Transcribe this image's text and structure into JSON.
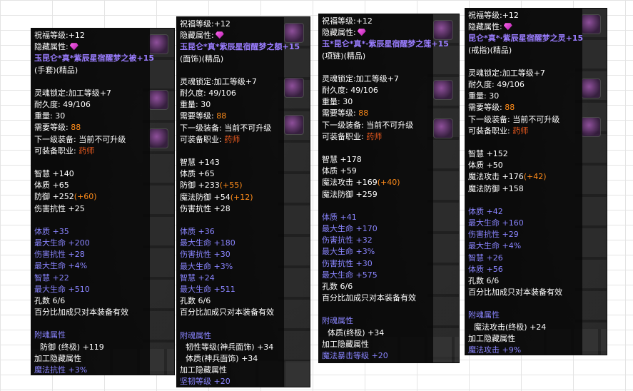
{
  "panels": [
    {
      "bless": "祝福等级:+12",
      "hidden": "隐藏属性:",
      "title": "玉昆仑*真*紫辰星宿醒梦之被+15",
      "type": "(手套)(精品)",
      "soul": "灵魂锁定:加工等级+7",
      "dur": "耐久度: 49/106",
      "weight": "重量: 30",
      "req_label": "需要等级:",
      "req_val": "88",
      "next": "下一级装备: 当前不可升级",
      "job_label": "可装备职业:",
      "job_val": "药师",
      "base": [
        {
          "t": "智慧 +140",
          "b": ""
        },
        {
          "t": "体质 +65",
          "b": ""
        },
        {
          "t": "防御 +252",
          "b": "(+60)"
        },
        {
          "t": "伤害抗性 +25",
          "b": ""
        }
      ],
      "ext": [
        "体质      +35",
        "最大生命 +200",
        "伤害抗性 +28",
        "最大生命 +4%",
        "智慧      +22",
        "最大生命 +510"
      ],
      "holes": "孔数 6/6",
      "pct": "百分比加成只对本装备有效",
      "soul_hdr": "附魂属性",
      "soul_items": [
        "防御 (终极) +119"
      ],
      "proc_hdr": "加工隐藏属性",
      "proc_items": [
        "魔法抗性 +3%"
      ]
    },
    {
      "bless": "祝福等级:+12",
      "hidden": "隐藏属性:",
      "title": "玉昆仑*真*紫辰星宿醒梦之额+15",
      "type": "(面饰)(精品)",
      "soul": "灵魂锁定:加工等级+7",
      "dur": "耐久度: 49/106",
      "weight": "重量: 30",
      "req_label": "需要等级:",
      "req_val": "88",
      "next": "下一级装备: 当前不可升级",
      "job_label": "可装备职业:",
      "job_val": "药师",
      "base": [
        {
          "t": "智慧 +143",
          "b": ""
        },
        {
          "t": "体质 +65",
          "b": ""
        },
        {
          "t": "防御 +233",
          "b": "(+55)"
        },
        {
          "t": "魔法防御 +54",
          "b": "(+12)"
        },
        {
          "t": "伤害抗性 +28",
          "b": ""
        }
      ],
      "ext": [
        "体质      +36",
        "最大生命 +180",
        "伤害抗性 +30",
        "最大生命 +3%",
        "智慧      +24",
        "最大生命 +511"
      ],
      "holes": "孔数 6/6",
      "pct": "百分比加成只对本装备有效",
      "soul_hdr": "附魂属性",
      "soul_items": [
        "韧性等级(神兵面饰) +34",
        "体质(神兵面饰) +34"
      ],
      "proc_hdr": "加工隐藏属性",
      "proc_items": [
        "坚韧等级 +20"
      ]
    },
    {
      "bless": "祝福等级:+12",
      "hidden": "隐藏属性:",
      "title": "玉*昆仑*真*·紫辰星宿醒梦之莲+15",
      "type": "(项链)(精品)",
      "soul": "灵魂锁定:加工等级+7",
      "dur": "耐久度: 49/106",
      "weight": "重量: 30",
      "req_label": "需要等级:",
      "req_val": "88",
      "next": "下一级装备: 当前不可升级",
      "job_label": "可装备职业:",
      "job_val": "药师",
      "base": [
        {
          "t": "智慧 +178",
          "b": ""
        },
        {
          "t": "体质 +59",
          "b": ""
        },
        {
          "t": "魔法攻击 +169",
          "b": "(+40)"
        },
        {
          "t": "魔法防御 +259",
          "b": ""
        }
      ],
      "ext": [
        "体质      +41",
        "最大生命 +170",
        "伤害抗性 +32",
        "最大生命 +3%",
        "伤害抗性 +30",
        "最大生命 +575"
      ],
      "holes": "孔数 6/6",
      "pct": "百分比加成只对本装备有效",
      "soul_hdr": "附魂属性",
      "soul_items": [
        "体质(终极) +34"
      ],
      "proc_hdr": "加工隐藏属性",
      "proc_items": [
        "魔法暴击等级 +20"
      ]
    },
    {
      "bless": "祝福等级:+12",
      "hidden": "隐藏属性:",
      "title": "昆仑*真*·紫辰星宿醒梦之灵+15",
      "type": "(戒指)(精品)",
      "soul": "灵魂锁定:加工等级+7",
      "dur": "耐久度: 49/106",
      "weight": "重量: 30",
      "req_label": "需要等级:",
      "req_val": "88",
      "next": "下一级装备: 当前不可升级",
      "job_label": "可装备职业:",
      "job_val": "药师",
      "base": [
        {
          "t": "智慧 +152",
          "b": ""
        },
        {
          "t": "体质 +50",
          "b": ""
        },
        {
          "t": "魔法攻击 +176",
          "b": "(+42)"
        },
        {
          "t": "魔法防御 +158",
          "b": ""
        }
      ],
      "ext": [
        "体质      +42",
        "最大生命 +160",
        "伤害抗性 +29",
        "最大生命 +4%",
        "智慧      +26",
        "体质      +56"
      ],
      "holes": "孔数 6/6",
      "pct": "百分比加成只对本装备有效",
      "soul_hdr": "附魂属性",
      "soul_items": [
        "魔法攻击(终极) +24"
      ],
      "proc_hdr": "加工隐藏属性",
      "proc_items": [
        "魔法攻击 +9%"
      ]
    }
  ]
}
